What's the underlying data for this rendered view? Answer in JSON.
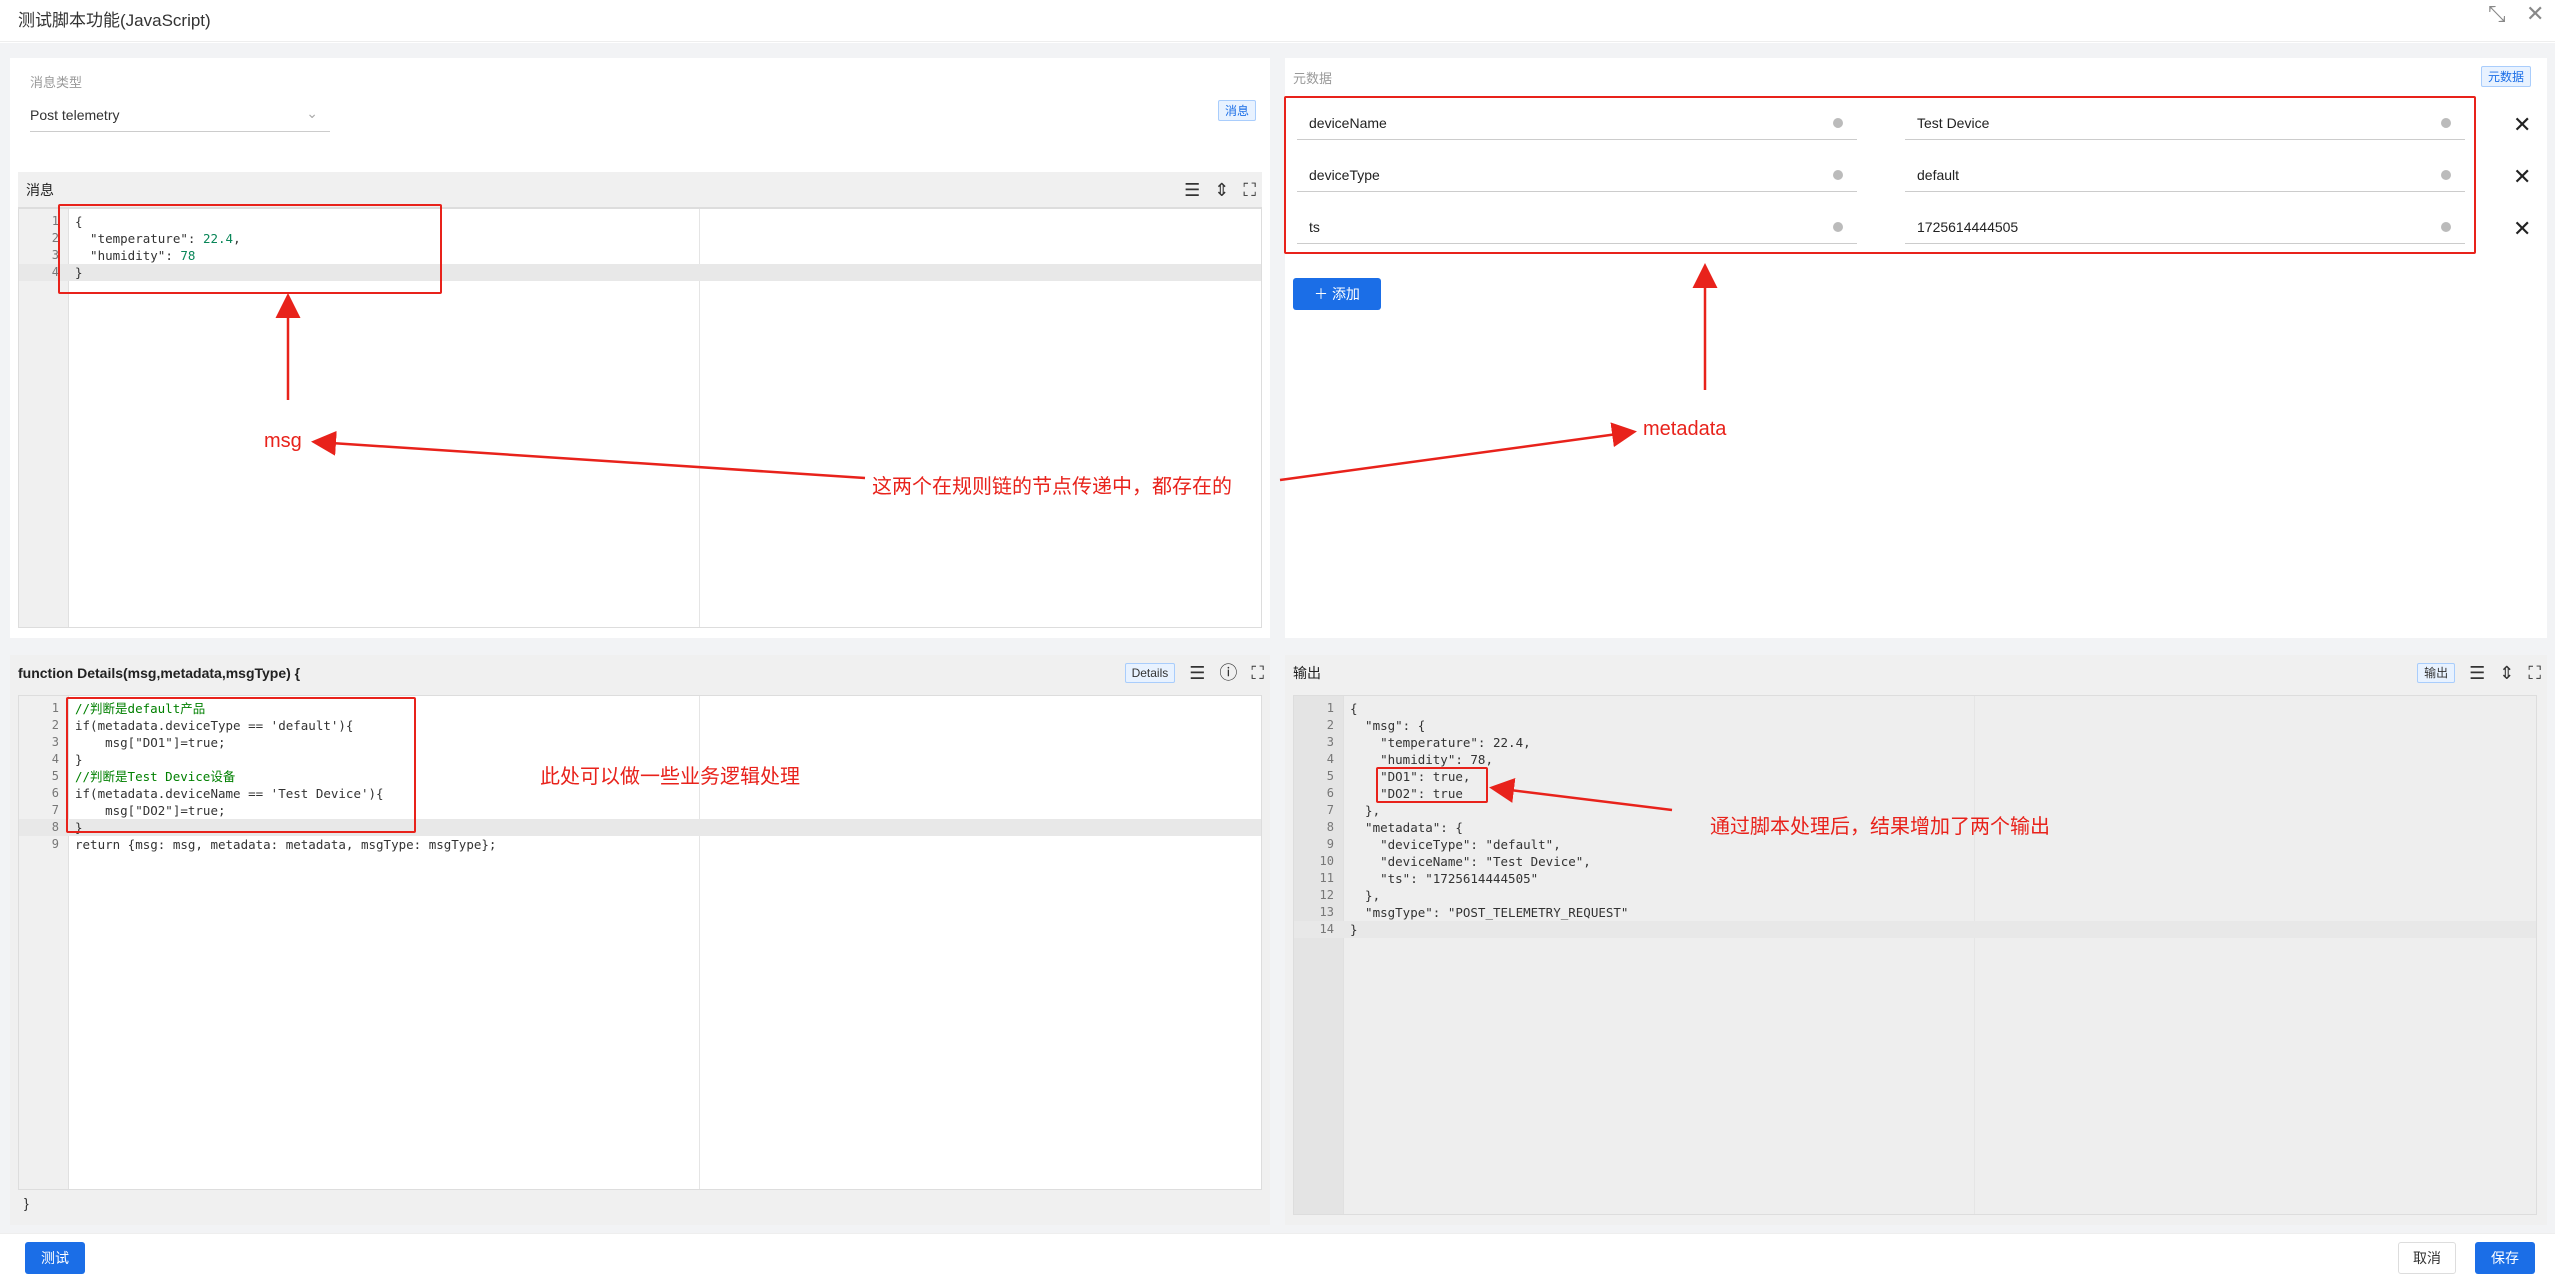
{
  "window": {
    "title": "测试脚本功能(JavaScript)"
  },
  "msg_panel": {
    "type_label": "消息类型",
    "type_value": "Post telemetry",
    "tag": "消息",
    "editor_title": "消息",
    "lines": [
      {
        "n": "1",
        "text": "{"
      },
      {
        "n": "2",
        "k": "  \"temperature\"",
        "sep": ": ",
        "v": "22.4",
        "end": ","
      },
      {
        "n": "3",
        "k": "  \"humidity\"",
        "sep": ": ",
        "v": "78",
        "end": ""
      },
      {
        "n": "4",
        "text": "}"
      }
    ]
  },
  "meta_panel": {
    "label": "元数据",
    "tag": "元数据",
    "rows": [
      {
        "key": "deviceName",
        "value": "Test Device"
      },
      {
        "key": "deviceType",
        "value": "default"
      },
      {
        "key": "ts",
        "value": "1725614444505"
      }
    ],
    "add_label": "添加"
  },
  "script_panel": {
    "header": "function Details(msg,metadata,msgType) {",
    "tag": "Details",
    "closing": "}",
    "lines": [
      {
        "n": "1",
        "text": "//判断是default产品",
        "cls": "k-com"
      },
      {
        "n": "2",
        "text": "if(metadata.deviceType == 'default'){"
      },
      {
        "n": "3",
        "text": "    msg[\"DO1\"]=true;"
      },
      {
        "n": "4",
        "text": "}"
      },
      {
        "n": "5",
        "text": "//判断是Test Device设备",
        "cls": "k-com"
      },
      {
        "n": "6",
        "text": "if(metadata.deviceName == 'Test Device'){"
      },
      {
        "n": "7",
        "text": "    msg[\"DO2\"]=true;"
      },
      {
        "n": "8",
        "text": "}"
      },
      {
        "n": "9",
        "text": "return {msg: msg, metadata: metadata, msgType: msgType};"
      }
    ]
  },
  "output_panel": {
    "title": "输出",
    "tag": "输出",
    "lines": [
      {
        "n": "1",
        "text": "{"
      },
      {
        "n": "2",
        "text": "  \"msg\": {"
      },
      {
        "n": "3",
        "text": "    \"temperature\": 22.4,"
      },
      {
        "n": "4",
        "text": "    \"humidity\": 78,"
      },
      {
        "n": "5",
        "text": "    \"DO1\": true,"
      },
      {
        "n": "6",
        "text": "    \"DO2\": true"
      },
      {
        "n": "7",
        "text": "  },"
      },
      {
        "n": "8",
        "text": "  \"metadata\": {"
      },
      {
        "n": "9",
        "text": "    \"deviceType\": \"default\","
      },
      {
        "n": "10",
        "text": "    \"deviceName\": \"Test Device\","
      },
      {
        "n": "11",
        "text": "    \"ts\": \"1725614444505\""
      },
      {
        "n": "12",
        "text": "  },"
      },
      {
        "n": "13",
        "text": "  \"msgType\": \"POST_TELEMETRY_REQUEST\""
      },
      {
        "n": "14",
        "text": "}"
      }
    ]
  },
  "annotations": {
    "msg": "msg",
    "metadata": "metadata",
    "both": "这两个在规则链的节点传递中，都存在的",
    "logic": "此处可以做一些业务逻辑处理",
    "result": "通过脚本处理后，结果增加了两个输出"
  },
  "footer": {
    "test": "测试",
    "cancel": "取消",
    "save": "保存"
  },
  "colors": {
    "primary": "#1b6ee7",
    "annotation": "#e8221b"
  }
}
